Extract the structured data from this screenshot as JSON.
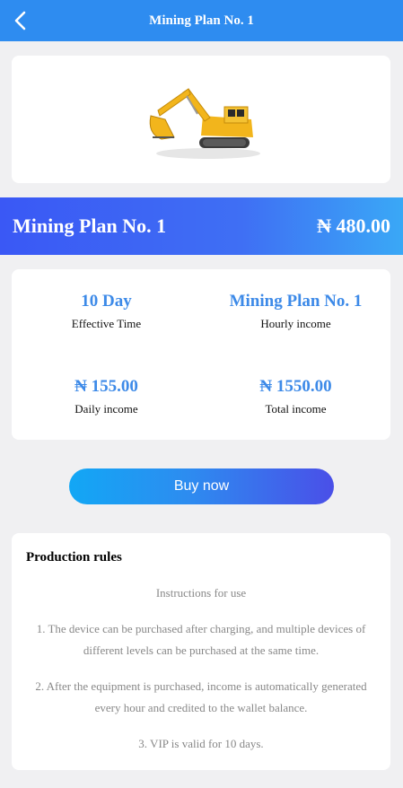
{
  "header": {
    "title": "Mining Plan No. 1"
  },
  "product": {
    "image_alt": "excavator-image",
    "name": "Mining Plan No. 1",
    "price": "₦ 480.00"
  },
  "stats": [
    {
      "value": "10 Day",
      "label": "Effective Time"
    },
    {
      "value": "Mining Plan No. 1",
      "label": "Hourly income"
    },
    {
      "value": "₦ 155.00",
      "label": "Daily income"
    },
    {
      "value": "₦ 1550.00",
      "label": "Total income"
    }
  ],
  "actions": {
    "buy_label": "Buy now"
  },
  "rules": {
    "title": "Production rules",
    "subtitle": "Instructions for use",
    "items": [
      "1. The device can be purchased after charging, and multiple devices of different levels can be purchased at the same time.",
      "2. After the equipment is purchased, income is automatically generated every hour and credited to the wallet balance.",
      "3. VIP is valid for 10 days."
    ]
  },
  "colors": {
    "header_bg": "#2e8cf0",
    "accent": "#3d8ae8",
    "page_bg": "#f0f0f2"
  }
}
